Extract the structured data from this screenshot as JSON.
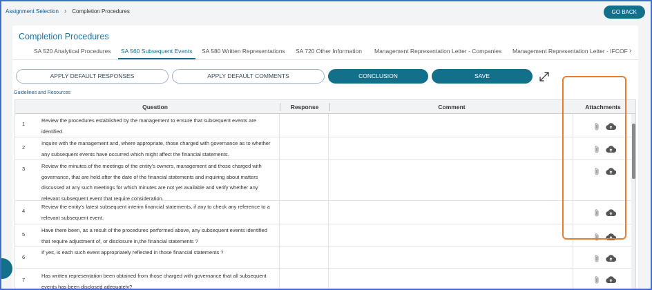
{
  "breadcrumb": {
    "root": "Assignment Selection",
    "separator": "›",
    "current": "Completion Procedures"
  },
  "header": {
    "go_back_label": "GO BACK"
  },
  "page": {
    "title": "Completion Procedures"
  },
  "tabs": [
    {
      "label": "SA 520 Analytical Procedures",
      "active": false
    },
    {
      "label": "SA 560 Subsequent Events",
      "active": true
    },
    {
      "label": "SA 580 Written Representations",
      "active": false
    },
    {
      "label": "SA 720 Other Information",
      "active": false
    },
    {
      "label": "Management Representation Letter - Companies",
      "active": false
    },
    {
      "label": "Management Representation Letter - IFCOF",
      "active": false
    }
  ],
  "tabs_next": "›",
  "actions": {
    "apply_default_responses": "APPLY DEFAULT RESPONSES",
    "apply_default_comments": "APPLY DEFAULT COMMENTS",
    "conclusion": "CONCLUSION",
    "save": "SAVE"
  },
  "guidelines_link": "Guidelines and Resources",
  "table": {
    "headers": {
      "question": "Question",
      "response": "Response",
      "comment": "Comment",
      "attachments": "Attachments"
    },
    "rows": [
      {
        "num": "1",
        "question": "Review the procedures established by the management to ensure that subsequent events are identified.",
        "response": "",
        "comment": ""
      },
      {
        "num": "2",
        "question": "Inquire with the management and, where appropriate, those charged with governance as to whether any subsequent events have occurred which might affect the financial statements.",
        "response": "",
        "comment": ""
      },
      {
        "num": "3",
        "question": "Review the minutes of the meetings of the entity's owners, management and those charged with governance, that are held after the date of the financial statements and inquiring about matters discussed at any such meetings for which minutes are not yet available and verify whether any relevant subsequent event that require consideration.",
        "response": "",
        "comment": ""
      },
      {
        "num": "4",
        "question": "Review the entity's latest subsequent interim financial statements, if any to check any reference to a relevant subsequent event.",
        "response": "",
        "comment": ""
      },
      {
        "num": "5",
        "question": "Have there been, as a result of the procedures performed above, any subsequent events identified that require adjustment of, or disclosure in,the financial statements ?",
        "response": "",
        "comment": ""
      },
      {
        "num": "6",
        "question": "If yes, is each such event appropriately reflected in those financial statements ?",
        "response": "",
        "comment": ""
      },
      {
        "num": "7",
        "question": "Has written representation been obtained from those charged with governance that all subsequent events has been disclosed adequately?",
        "response": "",
        "comment": ""
      }
    ]
  },
  "icons": {
    "attach": "paperclip-icon",
    "upload": "cloud-upload-icon",
    "expand": "expand-icon"
  },
  "colors": {
    "primary": "#12708a",
    "highlight": "#ea7d2c",
    "frame": "#3f6fc4"
  }
}
